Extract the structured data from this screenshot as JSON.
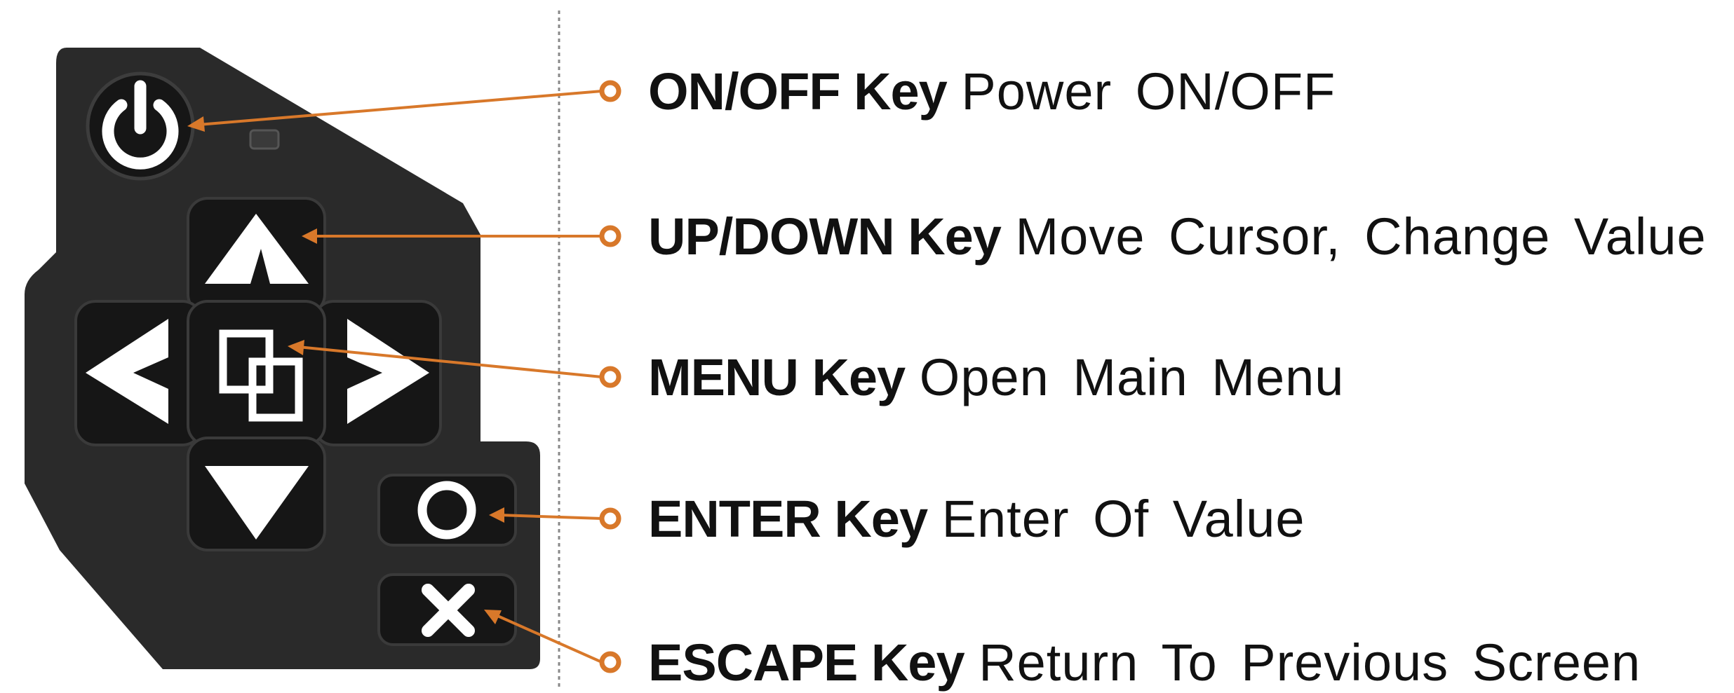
{
  "colors": {
    "callout": "#d8782a",
    "panel": "#2a2a2a",
    "key_cap": "#161616",
    "glyph": "#ffffff",
    "text": "#111111",
    "divider": "#888888"
  },
  "keys": [
    {
      "id": "on-off",
      "name": "ON/OFF Key",
      "description": "Power ON/OFF",
      "icon": "power-icon"
    },
    {
      "id": "up-down",
      "name": "UP/DOWN Key",
      "description": "Move Cursor, Change Value",
      "icon": "up-arrow-icon"
    },
    {
      "id": "menu",
      "name": "MENU Key",
      "description": "Open Main Menu",
      "icon": "menu-squares-icon"
    },
    {
      "id": "enter",
      "name": "ENTER Key",
      "description": "Enter Of Value",
      "icon": "circle-icon"
    },
    {
      "id": "escape",
      "name": "ESCAPE Key",
      "description": "Return To Previous Screen",
      "icon": "cross-icon"
    }
  ]
}
